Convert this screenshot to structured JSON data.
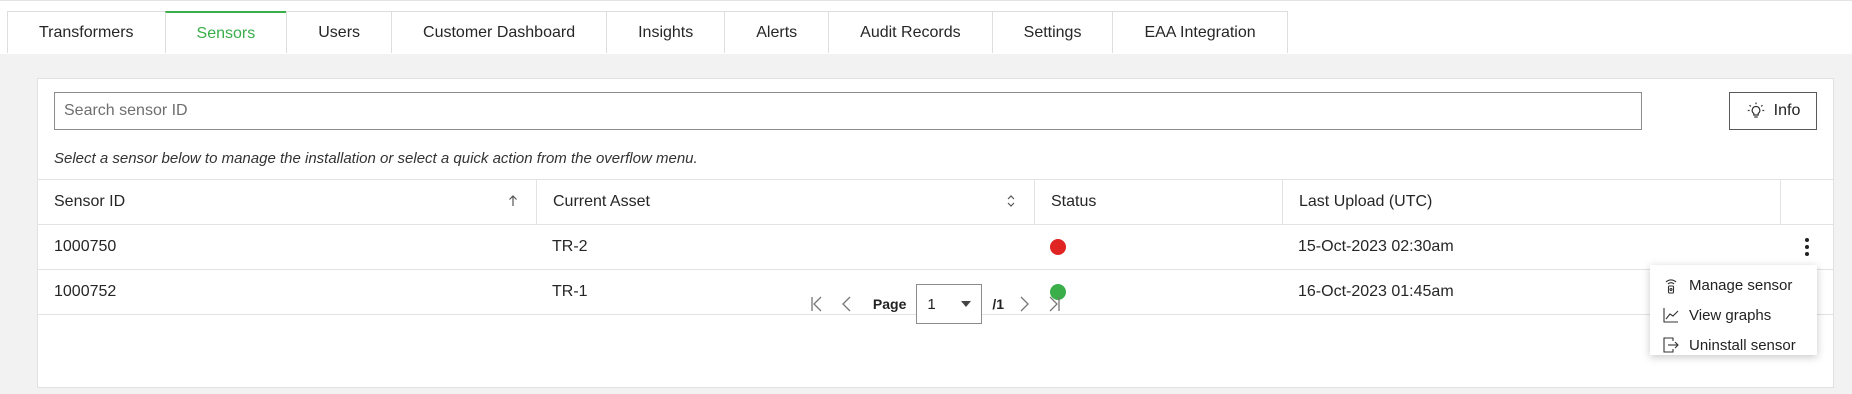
{
  "tabs": [
    {
      "label": "Transformers",
      "active": false
    },
    {
      "label": "Sensors",
      "active": true
    },
    {
      "label": "Users",
      "active": false
    },
    {
      "label": "Customer Dashboard",
      "active": false
    },
    {
      "label": "Insights",
      "active": false
    },
    {
      "label": "Alerts",
      "active": false
    },
    {
      "label": "Audit Records",
      "active": false
    },
    {
      "label": "Settings",
      "active": false
    },
    {
      "label": "EAA Integration",
      "active": false
    }
  ],
  "search": {
    "placeholder": "Search sensor ID",
    "value": ""
  },
  "info_button": {
    "label": "Info",
    "icon": "lightbulb-icon"
  },
  "hint": "Select a sensor below to manage the installation or select a quick action from the overflow menu.",
  "table": {
    "columns": [
      "Sensor ID",
      "Current Asset",
      "Status",
      "Last Upload (UTC)"
    ],
    "sort": {
      "column": "Sensor ID",
      "direction": "ascending"
    },
    "rows": [
      {
        "sensor_id": "1000750",
        "asset": "TR-2",
        "status": "red",
        "last_upload": "15-Oct-2023 02:30am"
      },
      {
        "sensor_id": "1000752",
        "asset": "TR-1",
        "status": "green",
        "last_upload": "16-Oct-2023 01:45am"
      }
    ]
  },
  "pagination": {
    "page_label": "Page",
    "current_page": "1",
    "total": "/1"
  },
  "overflow_menu": {
    "items": [
      {
        "label": "Manage sensor",
        "icon": "sensor-icon"
      },
      {
        "label": "View graphs",
        "icon": "line-graph-icon"
      },
      {
        "label": "Uninstall sensor",
        "icon": "exit-icon"
      }
    ]
  },
  "colors": {
    "accent": "#3aae49",
    "status_red": "#e02424",
    "status_green": "#3aae49"
  }
}
